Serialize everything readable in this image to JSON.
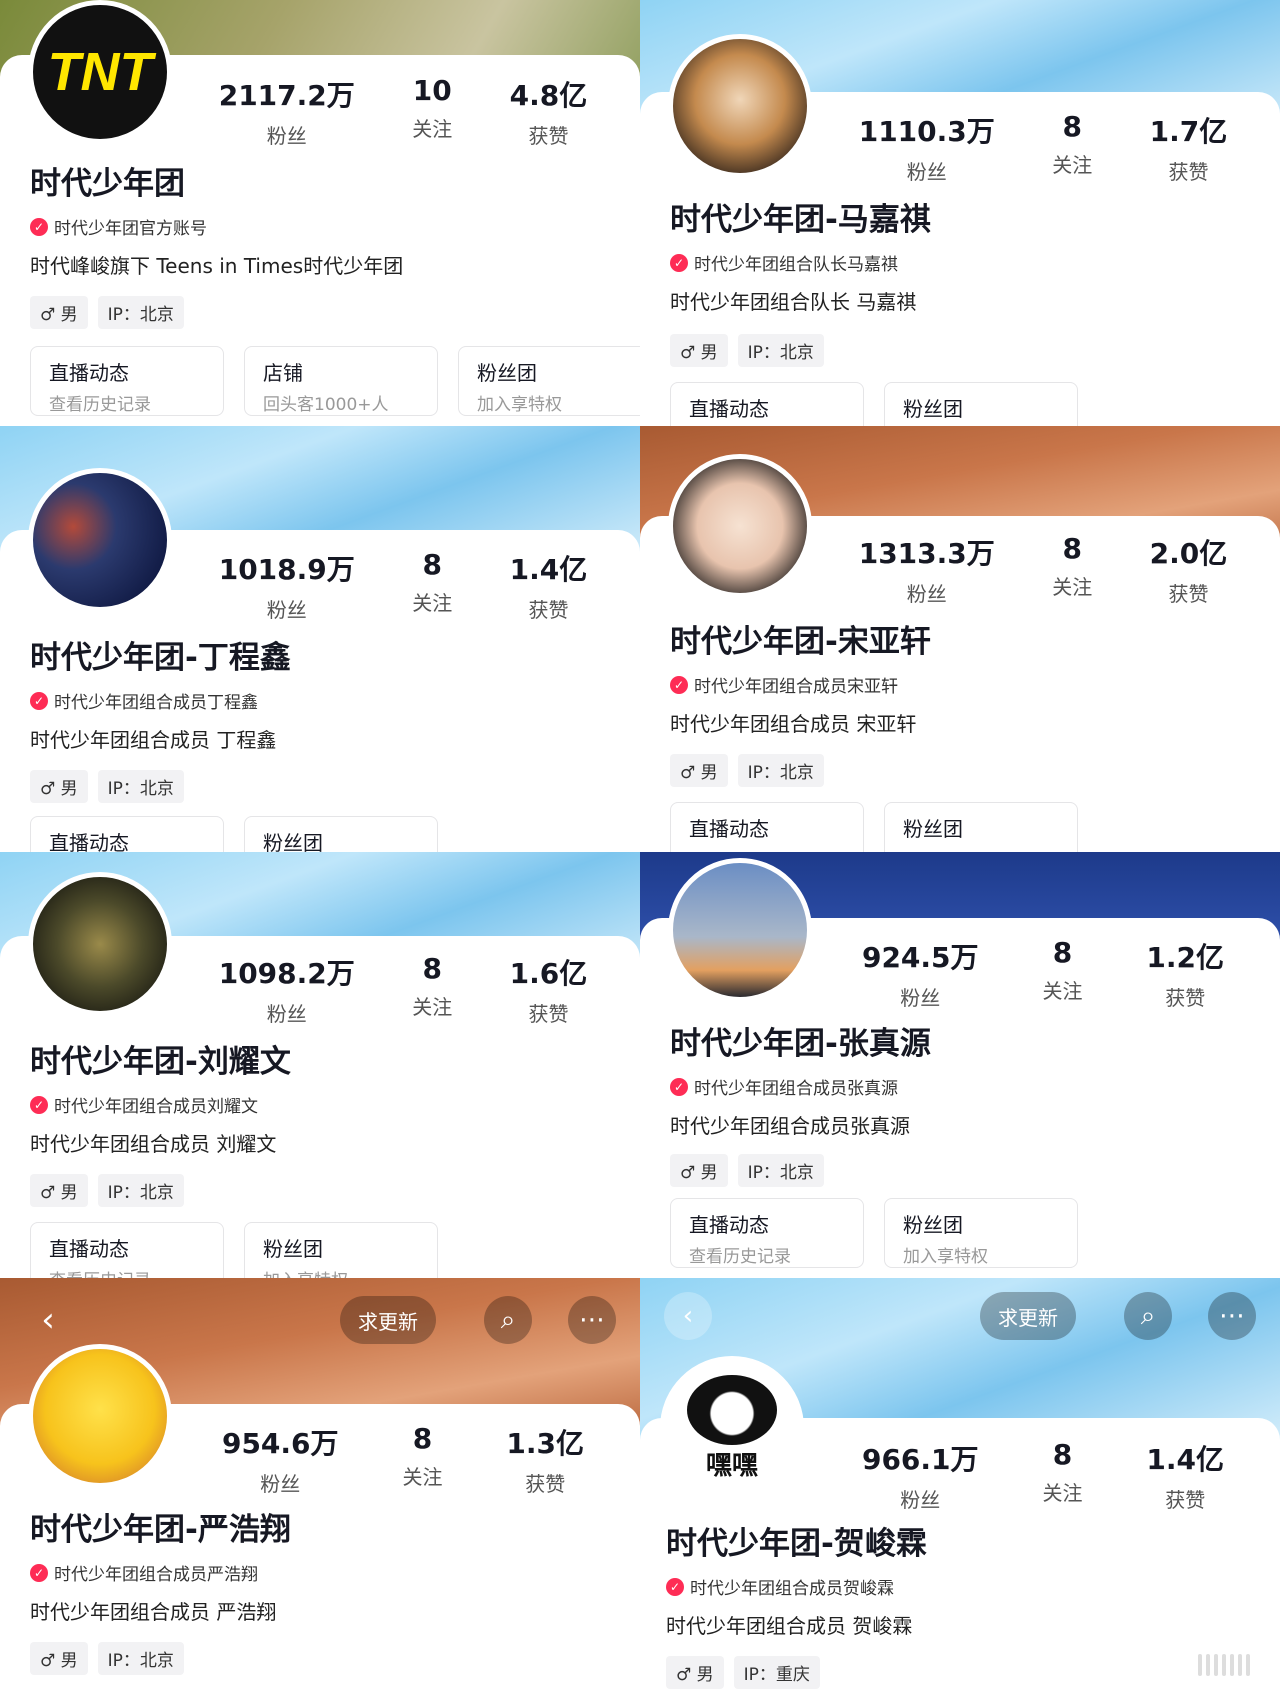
{
  "profiles": [
    {
      "name": "时代少年团",
      "verify": "时代少年团官方账号",
      "bio": "时代峰峻旗下 Teens in Times时代少年团",
      "gender": "♂ 男",
      "ip": "IP：北京",
      "stats": {
        "fans_value": "2117.2万",
        "fans_label": "粉丝",
        "follow_value": "10",
        "follow_label": "关注",
        "likes_value": "4.8亿",
        "likes_label": "获赞"
      },
      "buttons": [
        {
          "title": "直播动态",
          "sub": "查看历史记录"
        },
        {
          "title": "店铺",
          "sub": "回头客1000+人"
        },
        {
          "title": "粉丝团",
          "sub": "加入享特权"
        }
      ],
      "avatar_text": "TNT"
    },
    {
      "name": "时代少年团-马嘉祺",
      "verify": "时代少年团组合队长马嘉祺",
      "bio": "时代少年团组合队长 马嘉祺",
      "gender": "♂ 男",
      "ip": "IP：北京",
      "stats": {
        "fans_value": "1110.3万",
        "fans_label": "粉丝",
        "follow_value": "8",
        "follow_label": "关注",
        "likes_value": "1.7亿",
        "likes_label": "获赞"
      },
      "buttons": [
        {
          "title": "直播动态",
          "sub": ""
        },
        {
          "title": "粉丝团",
          "sub": ""
        }
      ]
    },
    {
      "name": "时代少年团-丁程鑫",
      "verify": "时代少年团组合成员丁程鑫",
      "bio": "时代少年团组合成员 丁程鑫",
      "gender": "♂ 男",
      "ip": "IP：北京",
      "stats": {
        "fans_value": "1018.9万",
        "fans_label": "粉丝",
        "follow_value": "8",
        "follow_label": "关注",
        "likes_value": "1.4亿",
        "likes_label": "获赞"
      },
      "buttons": [
        {
          "title": "直播动态",
          "sub": ""
        },
        {
          "title": "粉丝团",
          "sub": ""
        }
      ]
    },
    {
      "name": "时代少年团-宋亚轩",
      "verify": "时代少年团组合成员宋亚轩",
      "bio": "时代少年团组合成员 宋亚轩",
      "gender": "♂ 男",
      "ip": "IP：北京",
      "stats": {
        "fans_value": "1313.3万",
        "fans_label": "粉丝",
        "follow_value": "8",
        "follow_label": "关注",
        "likes_value": "2.0亿",
        "likes_label": "获赞"
      },
      "buttons": [
        {
          "title": "直播动态",
          "sub": ""
        },
        {
          "title": "粉丝团",
          "sub": ""
        }
      ]
    },
    {
      "name": "时代少年团-刘耀文",
      "verify": "时代少年团组合成员刘耀文",
      "bio": "时代少年团组合成员 刘耀文",
      "gender": "♂ 男",
      "ip": "IP：北京",
      "stats": {
        "fans_value": "1098.2万",
        "fans_label": "粉丝",
        "follow_value": "8",
        "follow_label": "关注",
        "likes_value": "1.6亿",
        "likes_label": "获赞"
      },
      "buttons": [
        {
          "title": "直播动态",
          "sub": "查看历史记录"
        },
        {
          "title": "粉丝团",
          "sub": "加入享特权"
        }
      ]
    },
    {
      "name": "时代少年团-张真源",
      "verify": "时代少年团组合成员张真源",
      "bio": "时代少年团组合成员张真源",
      "gender": "♂ 男",
      "ip": "IP：北京",
      "stats": {
        "fans_value": "924.5万",
        "fans_label": "粉丝",
        "follow_value": "8",
        "follow_label": "关注",
        "likes_value": "1.2亿",
        "likes_label": "获赞"
      },
      "buttons": [
        {
          "title": "直播动态",
          "sub": "查看历史记录"
        },
        {
          "title": "粉丝团",
          "sub": "加入享特权"
        }
      ]
    },
    {
      "name": "时代少年团-严浩翔",
      "verify": "时代少年团组合成员严浩翔",
      "bio": "时代少年团组合成员 严浩翔",
      "gender": "♂ 男",
      "ip": "IP：北京",
      "stats": {
        "fans_value": "954.6万",
        "fans_label": "粉丝",
        "follow_value": "8",
        "follow_label": "关注",
        "likes_value": "1.3亿",
        "likes_label": "获赞"
      },
      "topbar": {
        "request_update": "求更新"
      }
    },
    {
      "name": "时代少年团-贺峻霖",
      "verify": "时代少年团组合成员贺峻霖",
      "bio": "时代少年团组合成员 贺峻霖",
      "gender": "♂ 男",
      "ip": "IP：重庆",
      "stats": {
        "fans_value": "966.1万",
        "fans_label": "粉丝",
        "follow_value": "8",
        "follow_label": "关注",
        "likes_value": "1.4亿",
        "likes_label": "获赞"
      },
      "topbar": {
        "request_update": "求更新"
      },
      "avatar_text": "嘿嘿"
    }
  ],
  "icons": {
    "back": "chevron-left-icon",
    "search": "search-icon",
    "more": "more-icon",
    "verified": "verified-icon"
  },
  "colors": {
    "verified_red": "#fe2c55",
    "tnt_yellow": "#ffe600"
  }
}
